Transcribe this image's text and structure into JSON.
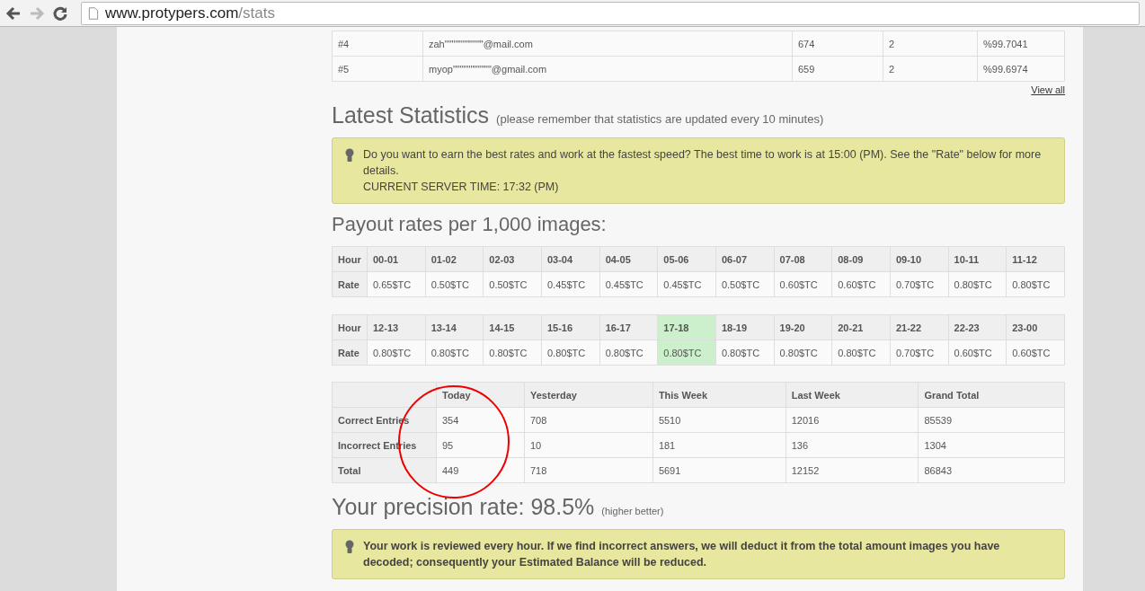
{
  "browser": {
    "url_host": "www.protypers.com",
    "url_path": "/stats"
  },
  "top_users": {
    "rows": [
      {
        "rank": "#4",
        "email": "zah\"\"\"\"\"\"\"\"\"\"\"@mail.com",
        "column_3": "674",
        "column_4": "2",
        "column_5": "%99.7041"
      },
      {
        "rank": "#5",
        "email": "myop\"\"\"\"\"\"\"\"\"\"\"@gmail.com",
        "column_3": "659",
        "column_4": "2",
        "column_5": "%99.6974"
      }
    ],
    "view_all": "View all"
  },
  "latest": {
    "title": "Latest Statistics",
    "subtitle": "(please remember that statistics are updated every 10 minutes)",
    "alert_lines": [
      "Do you want to earn the best rates and work at the fastest speed? The best time to work is at 15:00 (PM). See the \"Rate\" below for more details.",
      "CURRENT SERVER TIME: 17:32 (PM)"
    ]
  },
  "payout": {
    "title": "Payout rates per 1,000 images:",
    "tables": [
      {
        "hour_label": "Hour",
        "rate_label": "Rate",
        "slots": [
          {
            "hour": "00-01",
            "rate": "0.65$TC",
            "current": false
          },
          {
            "hour": "01-02",
            "rate": "0.50$TC",
            "current": false
          },
          {
            "hour": "02-03",
            "rate": "0.50$TC",
            "current": false
          },
          {
            "hour": "03-04",
            "rate": "0.45$TC",
            "current": false
          },
          {
            "hour": "04-05",
            "rate": "0.45$TC",
            "current": false
          },
          {
            "hour": "05-06",
            "rate": "0.45$TC",
            "current": false
          },
          {
            "hour": "06-07",
            "rate": "0.50$TC",
            "current": false
          },
          {
            "hour": "07-08",
            "rate": "0.60$TC",
            "current": false
          },
          {
            "hour": "08-09",
            "rate": "0.60$TC",
            "current": false
          },
          {
            "hour": "09-10",
            "rate": "0.70$TC",
            "current": false
          },
          {
            "hour": "10-11",
            "rate": "0.80$TC",
            "current": false
          },
          {
            "hour": "11-12",
            "rate": "0.80$TC",
            "current": false
          }
        ]
      },
      {
        "hour_label": "Hour",
        "rate_label": "Rate",
        "slots": [
          {
            "hour": "12-13",
            "rate": "0.80$TC",
            "current": false
          },
          {
            "hour": "13-14",
            "rate": "0.80$TC",
            "current": false
          },
          {
            "hour": "14-15",
            "rate": "0.80$TC",
            "current": false
          },
          {
            "hour": "15-16",
            "rate": "0.80$TC",
            "current": false
          },
          {
            "hour": "16-17",
            "rate": "0.80$TC",
            "current": false
          },
          {
            "hour": "17-18",
            "rate": "0.80$TC",
            "current": true
          },
          {
            "hour": "18-19",
            "rate": "0.80$TC",
            "current": false
          },
          {
            "hour": "19-20",
            "rate": "0.80$TC",
            "current": false
          },
          {
            "hour": "20-21",
            "rate": "0.80$TC",
            "current": false
          },
          {
            "hour": "21-22",
            "rate": "0.70$TC",
            "current": false
          },
          {
            "hour": "22-23",
            "rate": "0.60$TC",
            "current": false
          },
          {
            "hour": "23-00",
            "rate": "0.60$TC",
            "current": false
          }
        ]
      }
    ]
  },
  "entries": {
    "columns": [
      "Today",
      "Yesterday",
      "This Week",
      "Last Week",
      "Grand Total"
    ],
    "rows": [
      {
        "label": "Correct Entries",
        "values": [
          "354",
          "708",
          "5510",
          "12016",
          "85539"
        ]
      },
      {
        "label": "Incorrect Entries",
        "values": [
          "95",
          "10",
          "181",
          "136",
          "1304"
        ]
      },
      {
        "label": "Total",
        "values": [
          "449",
          "718",
          "5691",
          "12152",
          "86843"
        ]
      }
    ]
  },
  "precision": {
    "title": "Your precision rate: 98.5%",
    "note": "(higher better)",
    "alert": "Your work is reviewed every hour. If we find incorrect answers, we will deduct it from the total amount images you have decoded; consequently your Estimated Balance will be reduced."
  }
}
